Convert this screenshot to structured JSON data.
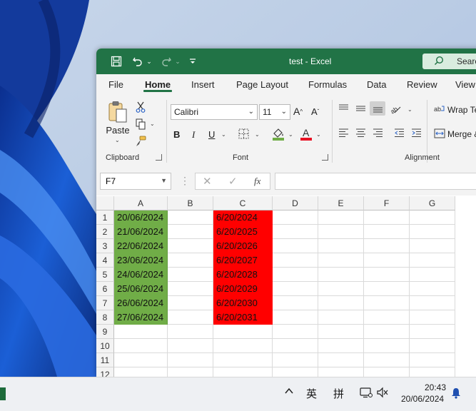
{
  "window": {
    "title": "test  -  Excel",
    "search_label": "Search"
  },
  "tabs": [
    "File",
    "Home",
    "Insert",
    "Page Layout",
    "Formulas",
    "Data",
    "Review",
    "View"
  ],
  "ribbon": {
    "clipboard": {
      "paste_label": "Paste",
      "group_label": "Clipboard"
    },
    "font": {
      "font_name": "Calibri",
      "font_size": "11",
      "group_label": "Font",
      "font_color": "#e81123",
      "fill_color": "#70ad47"
    },
    "alignment": {
      "wrap_text_label": "Wrap Te",
      "merge_label": "Merge &",
      "group_label": "Alignment"
    }
  },
  "formula_bar": {
    "name_box": "F7",
    "formula": ""
  },
  "columns": [
    "A",
    "B",
    "C",
    "D",
    "E",
    "F",
    "G"
  ],
  "rows": [
    {
      "num": "1",
      "a": "20/06/2024",
      "c": "6/20/2024"
    },
    {
      "num": "2",
      "a": "21/06/2024",
      "c": "6/20/2025"
    },
    {
      "num": "3",
      "a": "22/06/2024",
      "c": "6/20/2026"
    },
    {
      "num": "4",
      "a": "23/06/2024",
      "c": "6/20/2027"
    },
    {
      "num": "5",
      "a": "24/06/2024",
      "c": "6/20/2028"
    },
    {
      "num": "6",
      "a": "25/06/2024",
      "c": "6/20/2029"
    },
    {
      "num": "7",
      "a": "26/06/2024",
      "c": "6/20/2030"
    },
    {
      "num": "8",
      "a": "27/06/2024",
      "c": "6/20/2031"
    },
    {
      "num": "9",
      "a": "",
      "c": ""
    },
    {
      "num": "10",
      "a": "",
      "c": ""
    },
    {
      "num": "11",
      "a": "",
      "c": ""
    },
    {
      "num": "12",
      "a": "",
      "c": ""
    }
  ],
  "colors": {
    "excel_green": "#217346",
    "cell_green": "#70ad47",
    "cell_red": "#ff0000"
  },
  "taskbar": {
    "ime_lang": "英",
    "ime_mode": "拼",
    "time": "20:43",
    "date": "20/06/2024"
  }
}
